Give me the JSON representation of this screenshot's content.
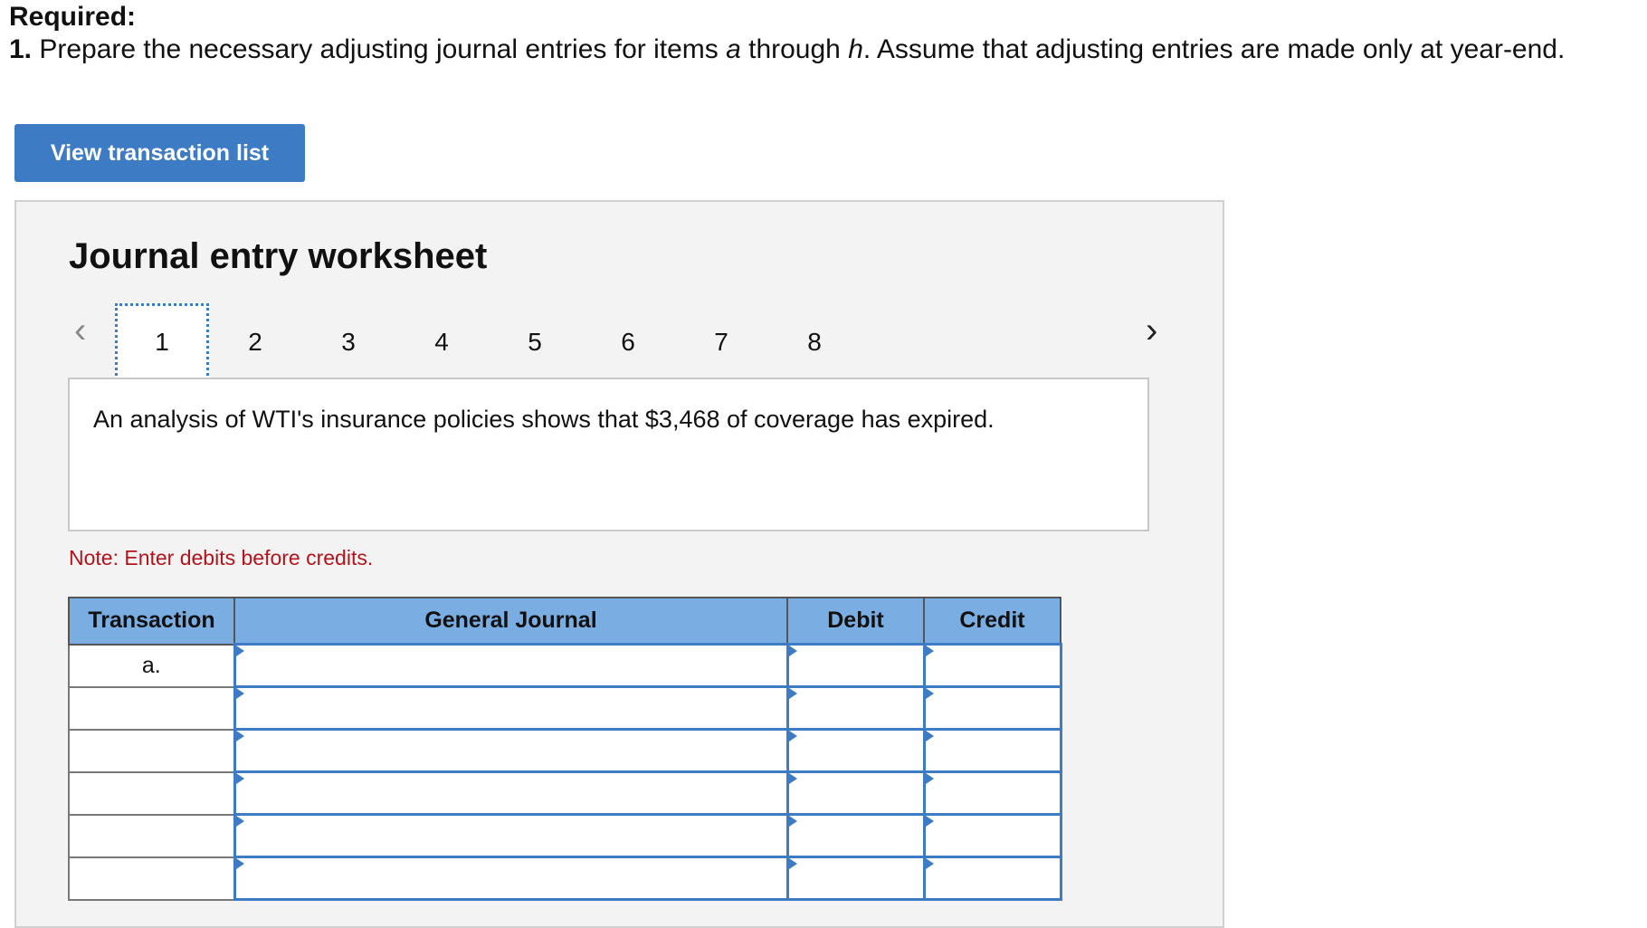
{
  "header": {
    "required_label": "Required:",
    "instruction_number": "1.",
    "instruction_text_1": " Prepare the necessary adjusting journal entries for items ",
    "item_a": "a",
    "instruction_text_2": " through ",
    "item_h": "h",
    "instruction_text_3": ". Assume that adjusting entries are made only at year-end."
  },
  "view_button": "View transaction list",
  "worksheet": {
    "title": "Journal entry worksheet",
    "tabs": [
      "1",
      "2",
      "3",
      "4",
      "5",
      "6",
      "7",
      "8"
    ],
    "active_tab": "1",
    "description": "An analysis of WTI's insurance policies shows that $3,468 of coverage has expired.",
    "note": "Note: Enter debits before credits.",
    "table": {
      "headers": [
        "Transaction",
        "General Journal",
        "Debit",
        "Credit"
      ],
      "rows": [
        {
          "transaction": "a.",
          "account": "",
          "debit": "",
          "credit": ""
        },
        {
          "transaction": "",
          "account": "",
          "debit": "",
          "credit": ""
        },
        {
          "transaction": "",
          "account": "",
          "debit": "",
          "credit": ""
        },
        {
          "transaction": "",
          "account": "",
          "debit": "",
          "credit": ""
        },
        {
          "transaction": "",
          "account": "",
          "debit": "",
          "credit": ""
        },
        {
          "transaction": "",
          "account": "",
          "debit": "",
          "credit": ""
        }
      ]
    }
  },
  "colors": {
    "button": "#3d7bc4",
    "header_bg": "#7aaee3",
    "note": "#b3131b"
  }
}
